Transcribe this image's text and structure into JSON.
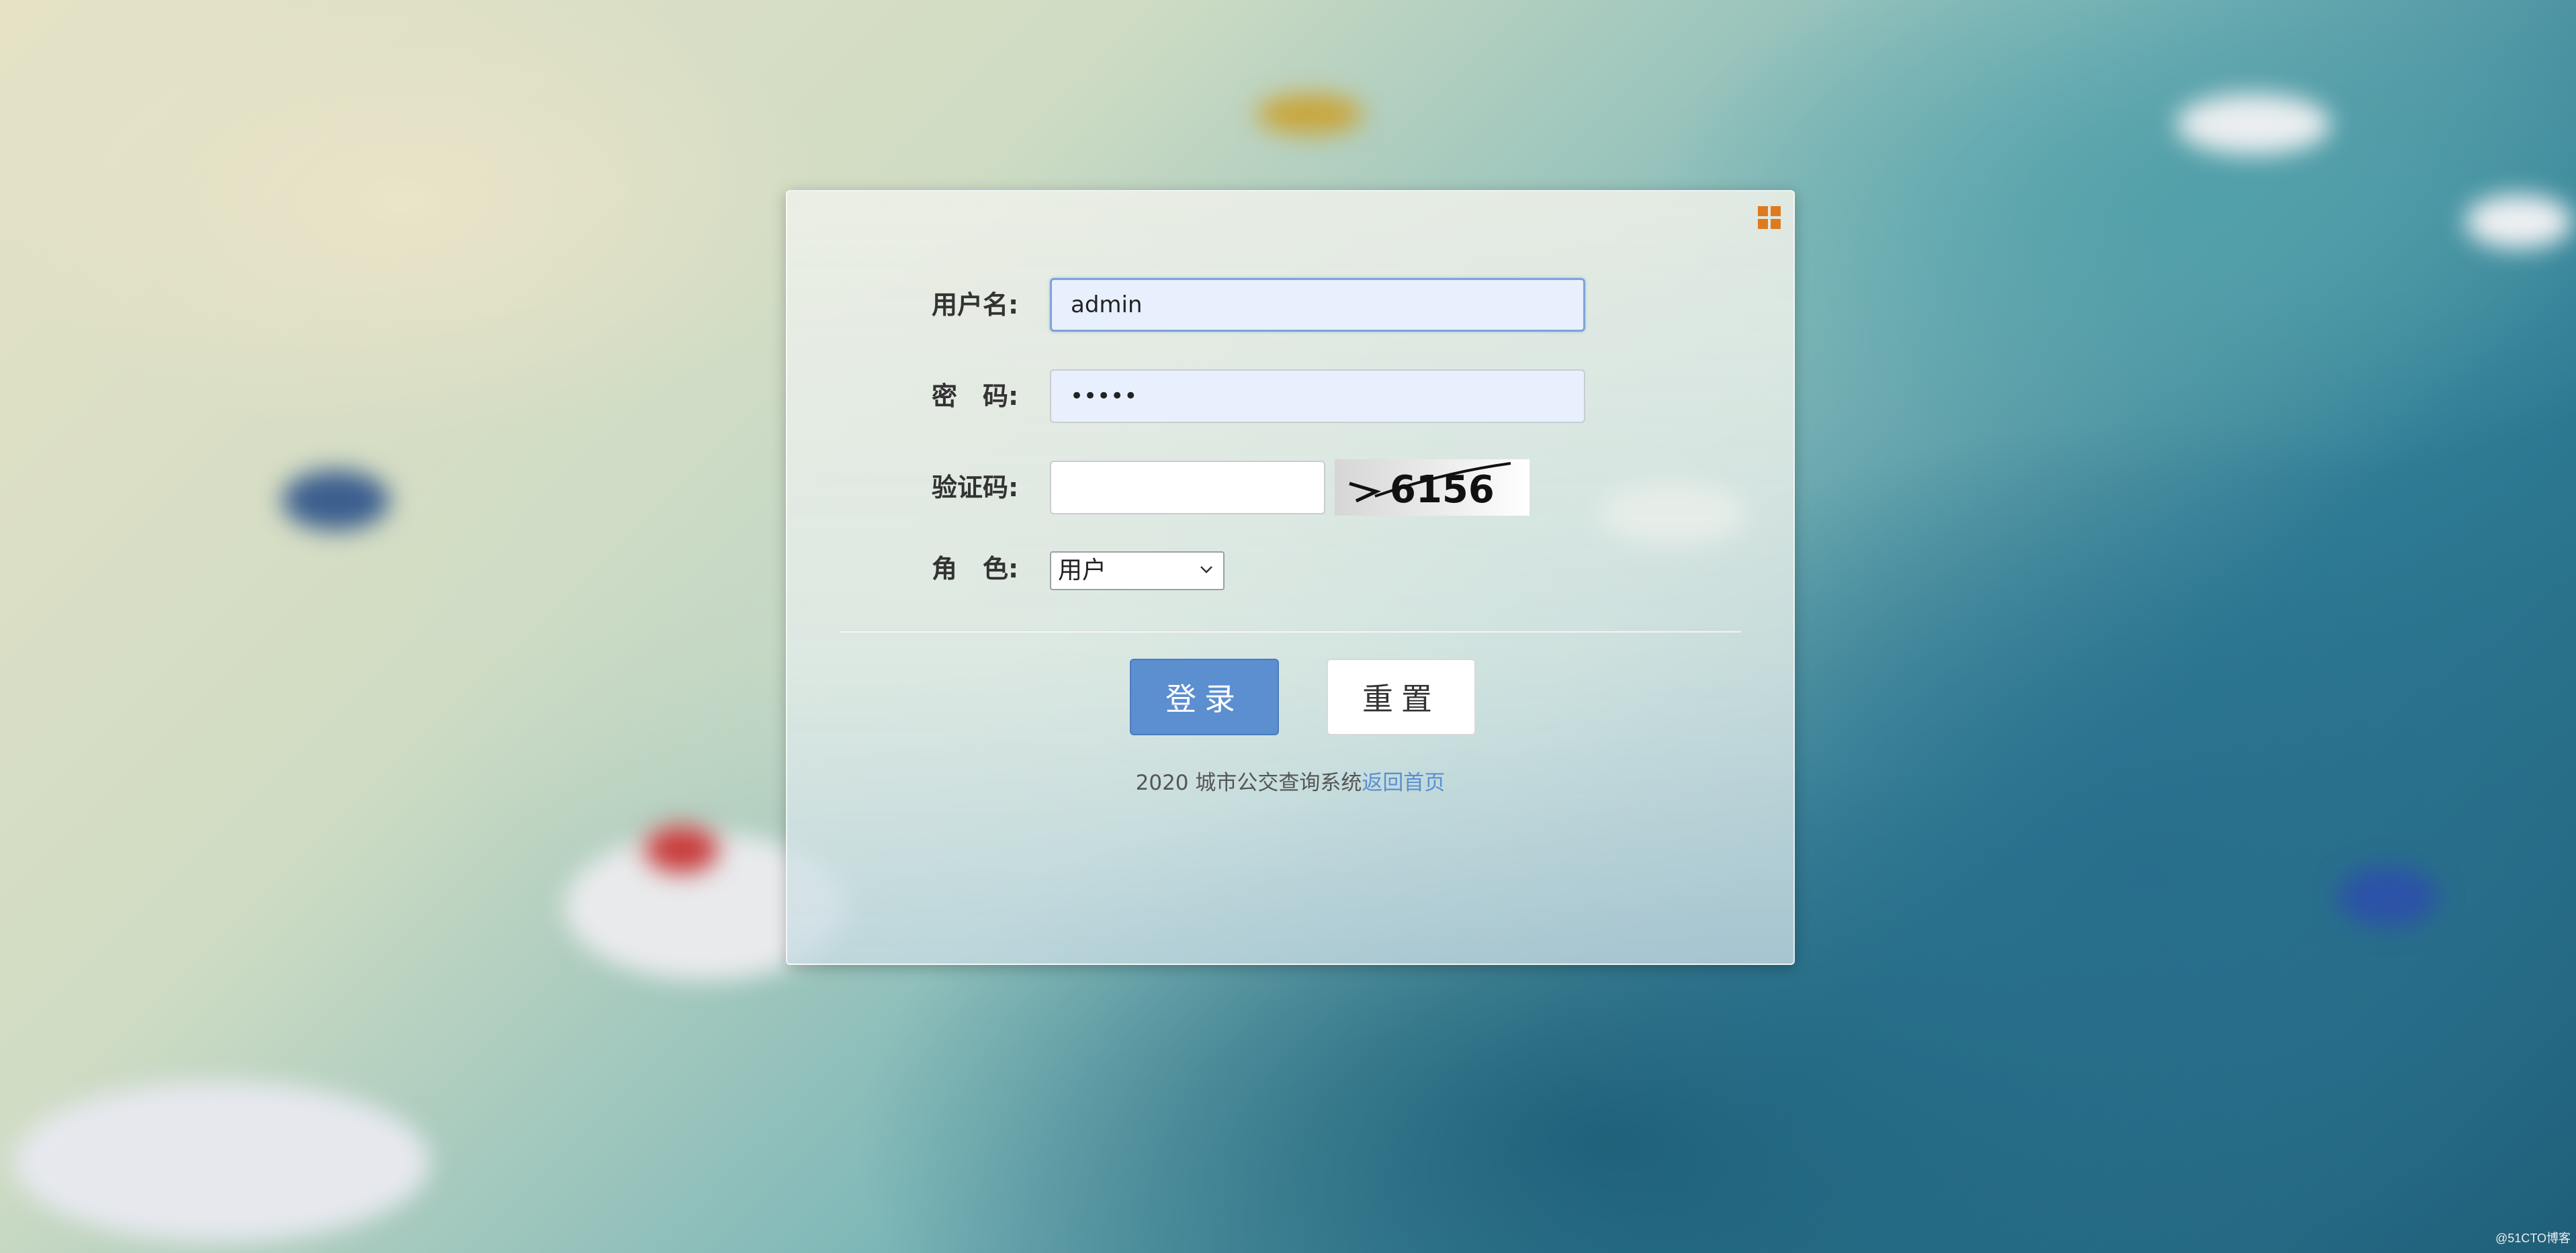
{
  "form": {
    "username_label": "用户名:",
    "username_value": "admin",
    "password_label": "密　码:",
    "password_value": "•••••",
    "captcha_label": "验证码:",
    "captcha_value": "",
    "captcha_image_text": "6156",
    "role_label": "角　色:",
    "role_selected": "用户"
  },
  "buttons": {
    "login_label": "登录",
    "reset_label": "重置"
  },
  "footer": {
    "text": "2020 城市公交查询系统",
    "link_text": "返回首页"
  },
  "watermark": "@51CTO博客",
  "colors": {
    "login_button": "#5c8fcf",
    "link": "#5b8fd0",
    "corner_icon": "#e07a1f"
  }
}
